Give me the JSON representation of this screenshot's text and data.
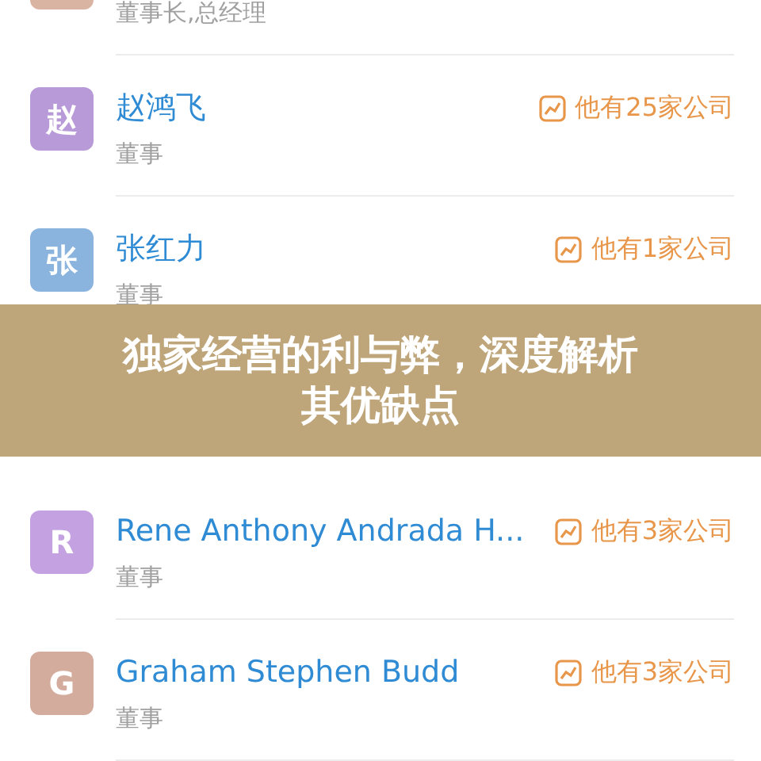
{
  "people_top": [
    {
      "color": "#d9b4a2",
      "role": "董事长,总经理"
    },
    {
      "avatar": "赵",
      "color": "#b89ad8",
      "name": "赵鸿飞",
      "role": "董事",
      "companies": "他有25家公司"
    },
    {
      "avatar": "张",
      "color": "#8ab4de",
      "name": "张红力",
      "role": "董事",
      "companies": "他有1家公司"
    }
  ],
  "banner": {
    "lines": [
      "独家经营的利与弊，深度解析",
      "其优缺点"
    ]
  },
  "people_bottom": [
    {
      "avatar": "R",
      "color": "#c4a2e2",
      "name": "Rene Anthony Andrada H...",
      "role": "董事",
      "companies": "他有3家公司"
    },
    {
      "avatar": "G",
      "color": "#d4ac9d",
      "name": "Graham Stephen Budd",
      "role": "董事",
      "companies": "他有3家公司"
    }
  ]
}
